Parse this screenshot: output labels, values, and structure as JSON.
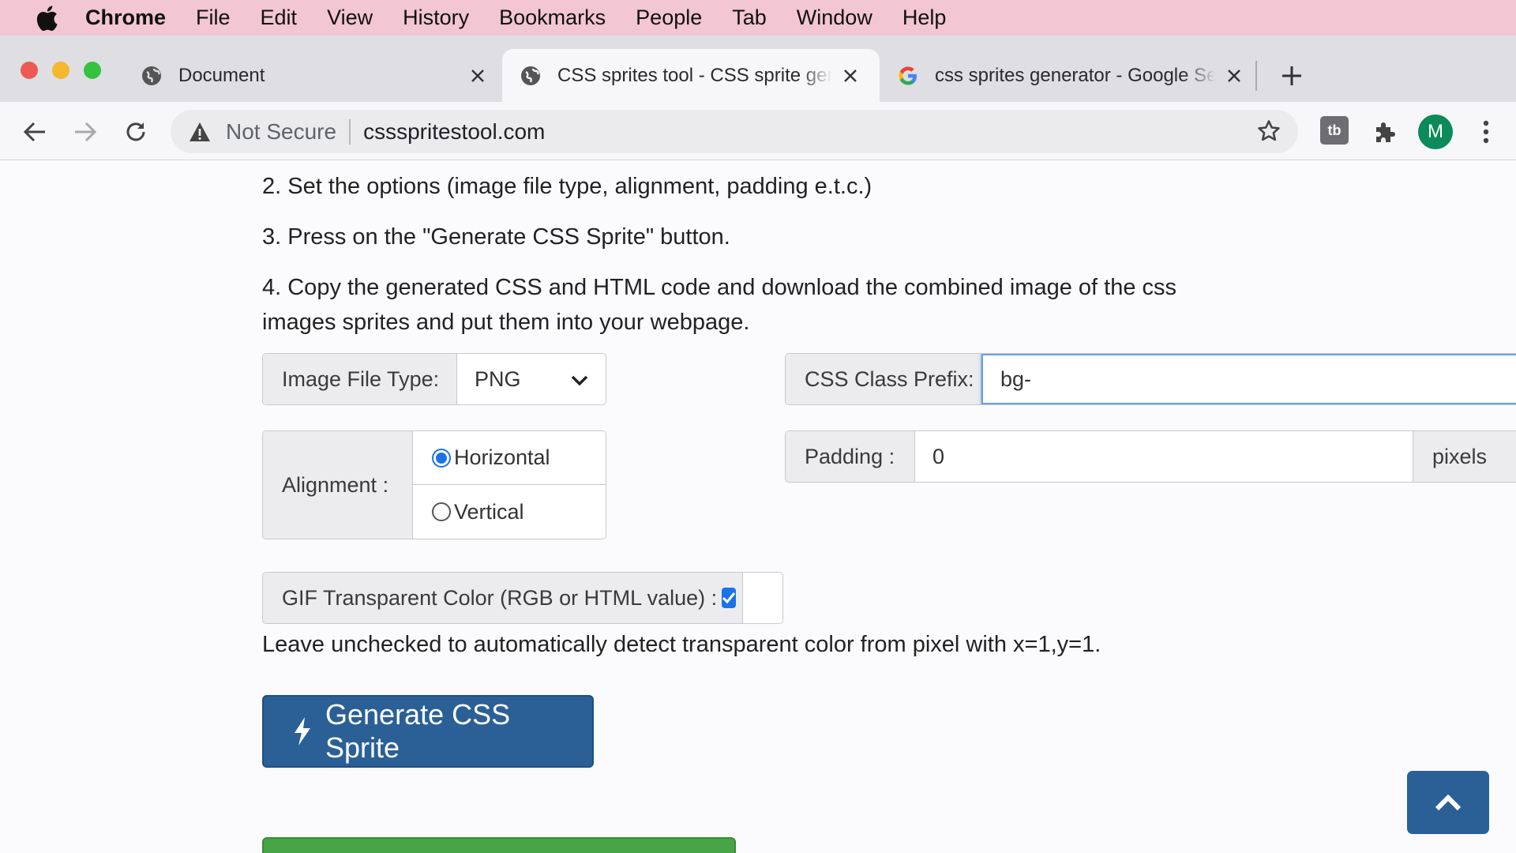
{
  "menubar": {
    "app": "Chrome",
    "items": [
      "File",
      "Edit",
      "View",
      "History",
      "Bookmarks",
      "People",
      "Tab",
      "Window",
      "Help"
    ]
  },
  "tabs": [
    {
      "title": "Document",
      "favicon": "globe-icon"
    },
    {
      "title": "CSS sprites tool - CSS sprite generator",
      "favicon": "globe-icon"
    },
    {
      "title": "css sprites generator - Google Search",
      "favicon": "google-icon"
    }
  ],
  "toolbar": {
    "security_label": "Not Secure",
    "url": "cssspritestool.com",
    "avatar_letter": "M",
    "extension_label": "tb"
  },
  "content": {
    "steps": [
      "2. Set the options (image file type, alignment, padding e.t.c.)",
      "3. Press on the \"Generate CSS Sprite\" button.",
      "4. Copy the generated CSS and HTML code and download the combined image of the css",
      "images sprites and put them into your webpage."
    ],
    "file_type": {
      "label": "Image File Type:",
      "selected": "PNG"
    },
    "class_prefix": {
      "label": "CSS Class Prefix:",
      "value": "bg-"
    },
    "alignment": {
      "label": "Alignment :",
      "options": [
        "Horizontal",
        "Vertical"
      ],
      "selected": "Horizontal"
    },
    "padding": {
      "label": "Padding :",
      "value": "0",
      "unit": "pixels"
    },
    "gif_transparent": {
      "label": "GIF Transparent Color (RGB or HTML value) :",
      "checked": true
    },
    "help_text": "Leave unchecked to automatically detect transparent color from pixel with x=1,y=1.",
    "generate_button": "Generate CSS Sprite"
  },
  "colors": {
    "primary_button": "#2a6096",
    "success_button": "#47a447",
    "focus_border": "#66a3e0",
    "menubar": "#f2c6d2"
  }
}
